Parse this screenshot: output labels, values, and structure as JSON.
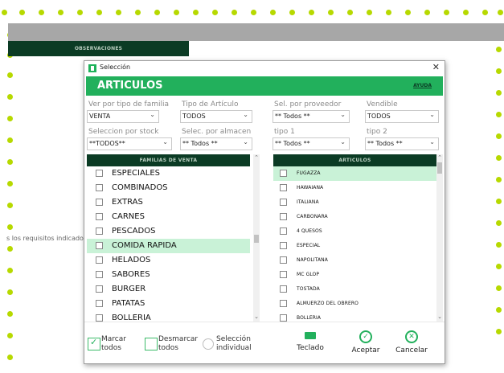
{
  "background": {
    "observations_header": "OBSERVACIONES",
    "requirements_text": "s los requisitos indicados",
    "accent_color": "#b7d900"
  },
  "dialog": {
    "title": "Selección",
    "close_icon": "close-icon",
    "header_title": "ARTICULOS",
    "help_label": "AYUDA",
    "filters": [
      {
        "label": "Ver por tipo de familia",
        "value": "VENTA"
      },
      {
        "label": "Tipo de Artículo",
        "value": "TODOS"
      },
      {
        "label": "Sel. por proveedor",
        "value": "** Todos **"
      },
      {
        "label": "Vendible",
        "value": "TODOS"
      },
      {
        "label": "Seleccion por stock",
        "value": "**TODOS**"
      },
      {
        "label": "Selec. por almacen",
        "value": "** Todos **"
      },
      {
        "label": "tipo 1",
        "value": "** Todos **"
      },
      {
        "label": "tipo 2",
        "value": "** Todos **"
      }
    ],
    "families_header": "FAMILIAS DE VENTA",
    "families": [
      "ESPECIALES",
      "COMBINADOS",
      "EXTRAS",
      "CARNES",
      "PESCADOS",
      "COMIDA RAPIDA",
      "HELADOS",
      "SABORES",
      "BURGER",
      "PATATAS",
      "BOLLERIA"
    ],
    "families_selected_index": 5,
    "articles_header": "ARTICULOS",
    "articles": [
      "FUGAZZA",
      "HAWAIANA",
      "ITALIANA",
      "CARBONARA",
      "4 QUESOS",
      "ESPECIAL",
      "NAPOLITANA",
      "MC GLOP",
      "TOSTADA",
      "ALMUERZO DEL OBRERO",
      "BOLLERIA"
    ],
    "articles_selected_index": 0,
    "footer": {
      "mark_all": [
        "Marcar",
        "todos"
      ],
      "unmark_all": [
        "Desmarcar",
        "todos"
      ],
      "individual": [
        "Selección",
        "individual"
      ],
      "keyboard": "Teclado",
      "accept": "Aceptar",
      "cancel": "Cancelar"
    },
    "colors": {
      "header": "#22b05c",
      "list_header": "#0b3b24",
      "highlight": "#c9f2d7"
    }
  }
}
